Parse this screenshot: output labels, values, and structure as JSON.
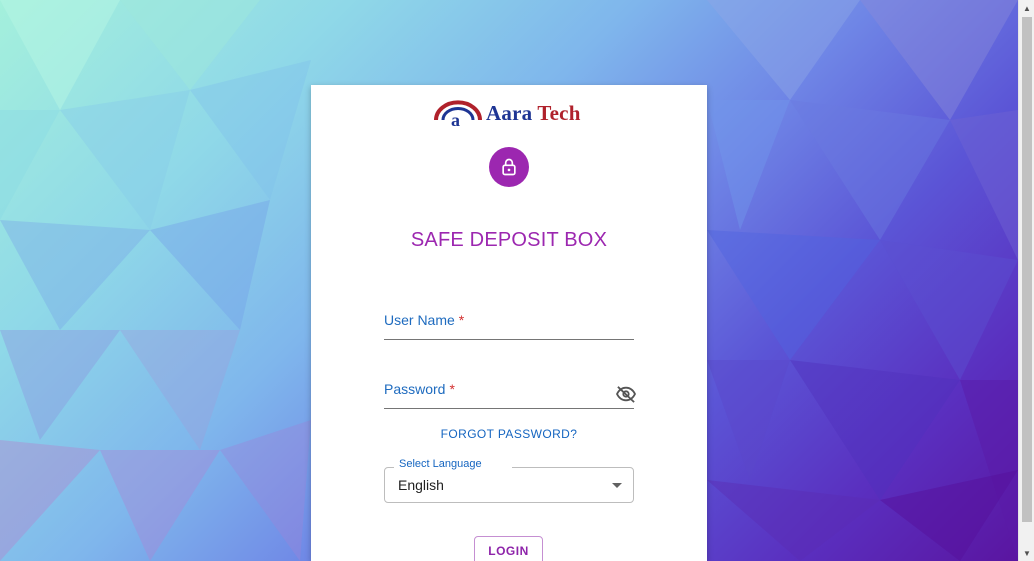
{
  "brand": {
    "logo_word_1": "Aara",
    "logo_word_2": "Tech",
    "logo_glyph": "a",
    "arc_color": "#b0212b",
    "text_color": "#1e3594"
  },
  "header": {
    "avatar_icon": "lock-icon",
    "avatar_color": "#9c27b0",
    "title": "SAFE DEPOSIT BOX"
  },
  "form": {
    "username": {
      "label": "User Name",
      "required_mark": "*",
      "value": ""
    },
    "password": {
      "label": "Password",
      "required_mark": "*",
      "value": "",
      "toggle_icon": "visibility-off-icon"
    },
    "forgot_link": "FORGOT PASSWORD?",
    "language": {
      "legend": "Select Language",
      "selected": "English"
    },
    "login_button": "LOGIN"
  },
  "colors": {
    "accent": "#9c27b0",
    "link": "#1565c0",
    "required": "#d32f2f"
  }
}
